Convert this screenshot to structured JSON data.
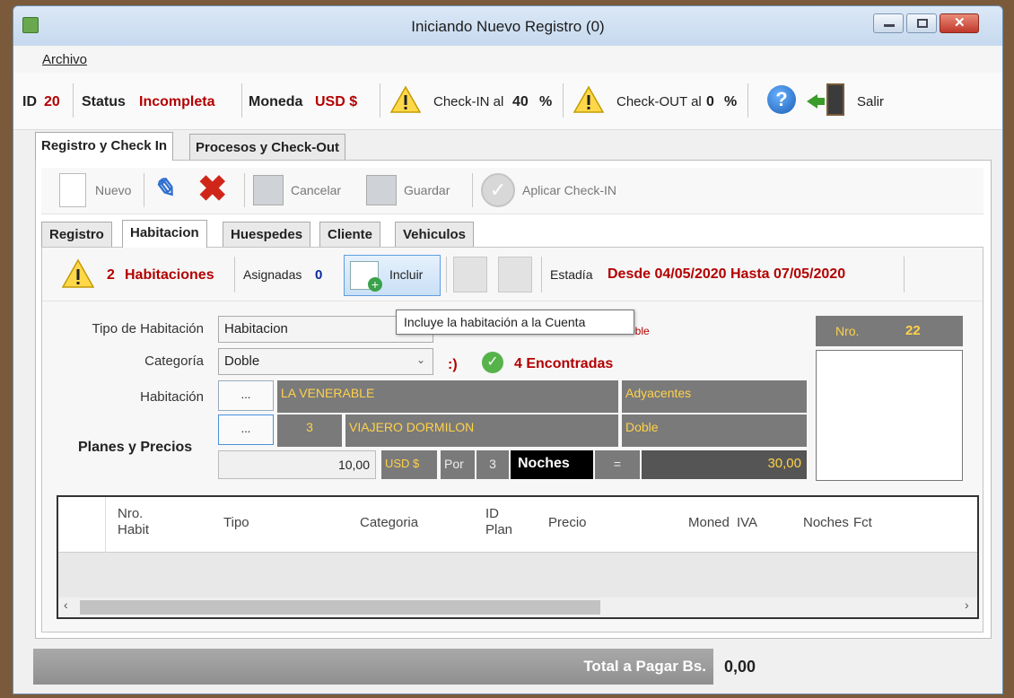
{
  "window": {
    "title": "Iniciando Nuevo Registro (0)"
  },
  "menu": {
    "archivo": "Archivo"
  },
  "info": {
    "id_label": "ID",
    "id_value": "20",
    "status_label": "Status",
    "status_value": "Incompleta",
    "moneda_label": "Moneda",
    "moneda_value": "USD $",
    "checkin_label": "Check-IN al",
    "checkin_value": "40",
    "checkin_pct": "%",
    "checkout_label": "Check-OUT al",
    "checkout_value": "0",
    "checkout_pct": "%",
    "salir": "Salir"
  },
  "main_tabs": [
    "Registro y Check In",
    "Procesos y Check-Out"
  ],
  "toolbar": {
    "nuevo": "Nuevo",
    "cancelar": "Cancelar",
    "guardar": "Guardar",
    "aplicar": "Aplicar Check-IN"
  },
  "sub_tabs": [
    "Registro",
    "Habitacion",
    "Huespedes",
    "Cliente",
    "Vehiculos"
  ],
  "hab_bar": {
    "count": "2",
    "count_label": "Habitaciones",
    "asignadas_label": "Asignadas",
    "asignadas_value": "0",
    "incluir": "Incluir",
    "estadia_label": "Estadía",
    "estadia_value": "Desde 04/05/2020 Hasta 07/05/2020"
  },
  "tooltip": "Incluye la habitación a la Cuenta",
  "form": {
    "tipo_label": "Tipo de Habitación",
    "tipo_value": "Habitacion",
    "tipo_hint": "oble",
    "categoria_label": "Categoría",
    "categoria_value": "Doble",
    "smile": ":)",
    "encontradas": "4 Encontradas",
    "habitacion_label": "Habitación",
    "dots": "...",
    "hab_name": "LA VENERABLE",
    "hab_adj": "Adyacentes",
    "plan_num": "3",
    "plan_name": "VIAJERO DORMILON",
    "plan_tipo": "Doble",
    "planes_label": "Planes y Precios",
    "precio": "10,00",
    "moneda": "USD $",
    "por": "Por",
    "noches_num": "3",
    "noches": "Noches",
    "igual": "=",
    "total": "30,00",
    "nro_label": "Nro.",
    "nro_value": "22"
  },
  "grid": {
    "columns": [
      "Nro.\nHabit",
      "Tipo",
      "Categoria",
      "ID\nPlan",
      "Precio",
      "Moned",
      "IVA",
      "Noches",
      "Fct"
    ]
  },
  "footer": {
    "total_label": "Total a Pagar Bs.",
    "total_value": "0,00"
  },
  "colors": {
    "accent_red": "#b30000",
    "field_gray": "#7a7a7a",
    "field_text": "#ffd24a"
  }
}
